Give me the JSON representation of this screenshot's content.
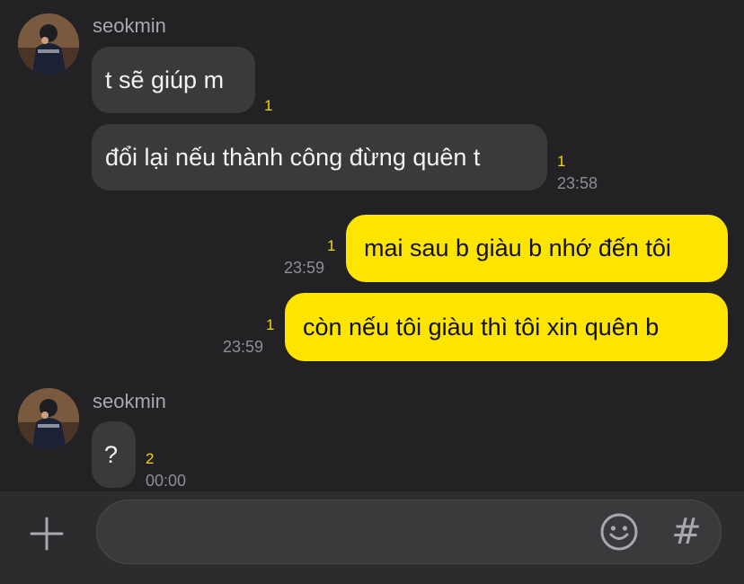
{
  "conversation": {
    "groups": [
      {
        "sender": "seokmin",
        "messages": [
          {
            "text": "t sẽ giúp m",
            "unread": "1",
            "time": ""
          },
          {
            "text": "đổi lại nếu thành công đừng quên t",
            "unread": "1",
            "time": "23:58"
          }
        ]
      },
      {
        "sender": "me",
        "messages": [
          {
            "text": "mai sau b giàu b nhớ đến tôi",
            "unread": "1",
            "time": "23:59"
          },
          {
            "text": "còn nếu tôi giàu thì tôi xin quên b",
            "unread": "1",
            "time": "23:59"
          }
        ]
      },
      {
        "sender": "seokmin",
        "messages": [
          {
            "text": "?",
            "unread": "2",
            "time": "00:00"
          }
        ]
      }
    ]
  },
  "composer": {
    "input_value": "",
    "plus_icon": "plus-icon",
    "emoji_icon": "smiley-icon",
    "hash_label": "#"
  },
  "colors": {
    "background": "#222224",
    "incoming_bubble": "#3a3a3c",
    "outgoing_bubble": "#fee500",
    "unread_count": "#f5d400",
    "timestamp": "#8e8e93"
  }
}
